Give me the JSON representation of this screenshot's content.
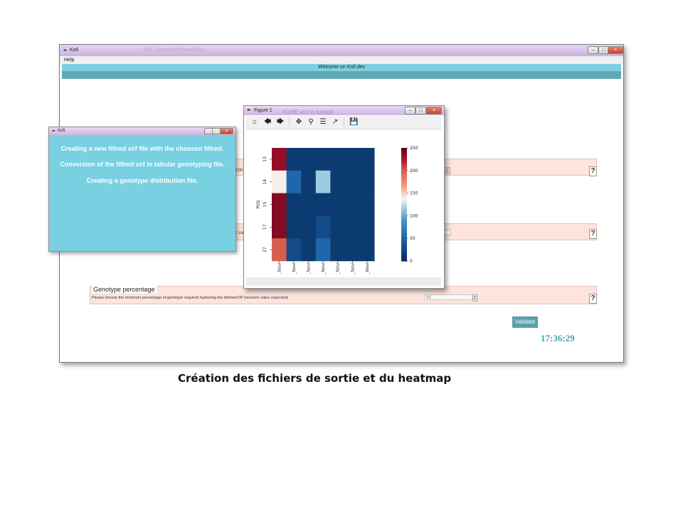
{
  "main_window": {
    "title": "Kofi",
    "taskbar_ghost": "Kofi - Microsoft PowerPoint",
    "menu": [
      "Help"
    ],
    "welcome": "Welcome on Kofi.dev",
    "section1": {
      "value": "100"
    },
    "section2": {
      "label_fragment": "c valu"
    },
    "genotype_section": {
      "title": "Genotype percentage",
      "description": "Please choose the minimum percentage of genotype required harboring the defined DP (numeric value expected)",
      "value": "95"
    },
    "validate_label": "Validate",
    "clock": "17:36:29"
  },
  "popup": {
    "title": "Kofi",
    "messages": [
      "Creating a new filtred vcf file with the choosen filtred.",
      "Conversion of the filtred vcf in tabular genotyping file.",
      "Creating a genotype distribution file."
    ]
  },
  "figure_window": {
    "title": "Figure 1",
    "behind_text": "KoffE vcf in heatol",
    "toolbar_icons": [
      "home-icon",
      "back-arrow-icon",
      "forward-arrow-icon",
      "pan-icon",
      "zoom-icon",
      "configure-subplots-icon",
      "edit-axis-icon",
      "save-icon"
    ]
  },
  "chart_data": {
    "type": "heatmap",
    "ylabel": "POS",
    "rows": [
      "13",
      "14",
      "15",
      "17",
      "27"
    ],
    "columns": [
      "_Total",
      "_Total",
      "_Total",
      "_Total",
      "_Total",
      "_Total",
      "_Total"
    ],
    "values": [
      [
        235,
        10,
        10,
        10,
        10,
        10,
        10
      ],
      [
        140,
        50,
        10,
        115,
        10,
        10,
        10
      ],
      [
        240,
        10,
        10,
        10,
        10,
        10,
        10
      ],
      [
        240,
        10,
        10,
        25,
        10,
        10,
        10
      ],
      [
        200,
        25,
        10,
        50,
        10,
        10,
        10
      ]
    ],
    "colorbar": {
      "min": 0,
      "max": 250,
      "ticks": [
        "0",
        "50",
        "100",
        "150",
        "200",
        "250"
      ],
      "colormap": "RdBu_r"
    }
  },
  "caption": "Création des fichiers de sortie et du heatmap"
}
